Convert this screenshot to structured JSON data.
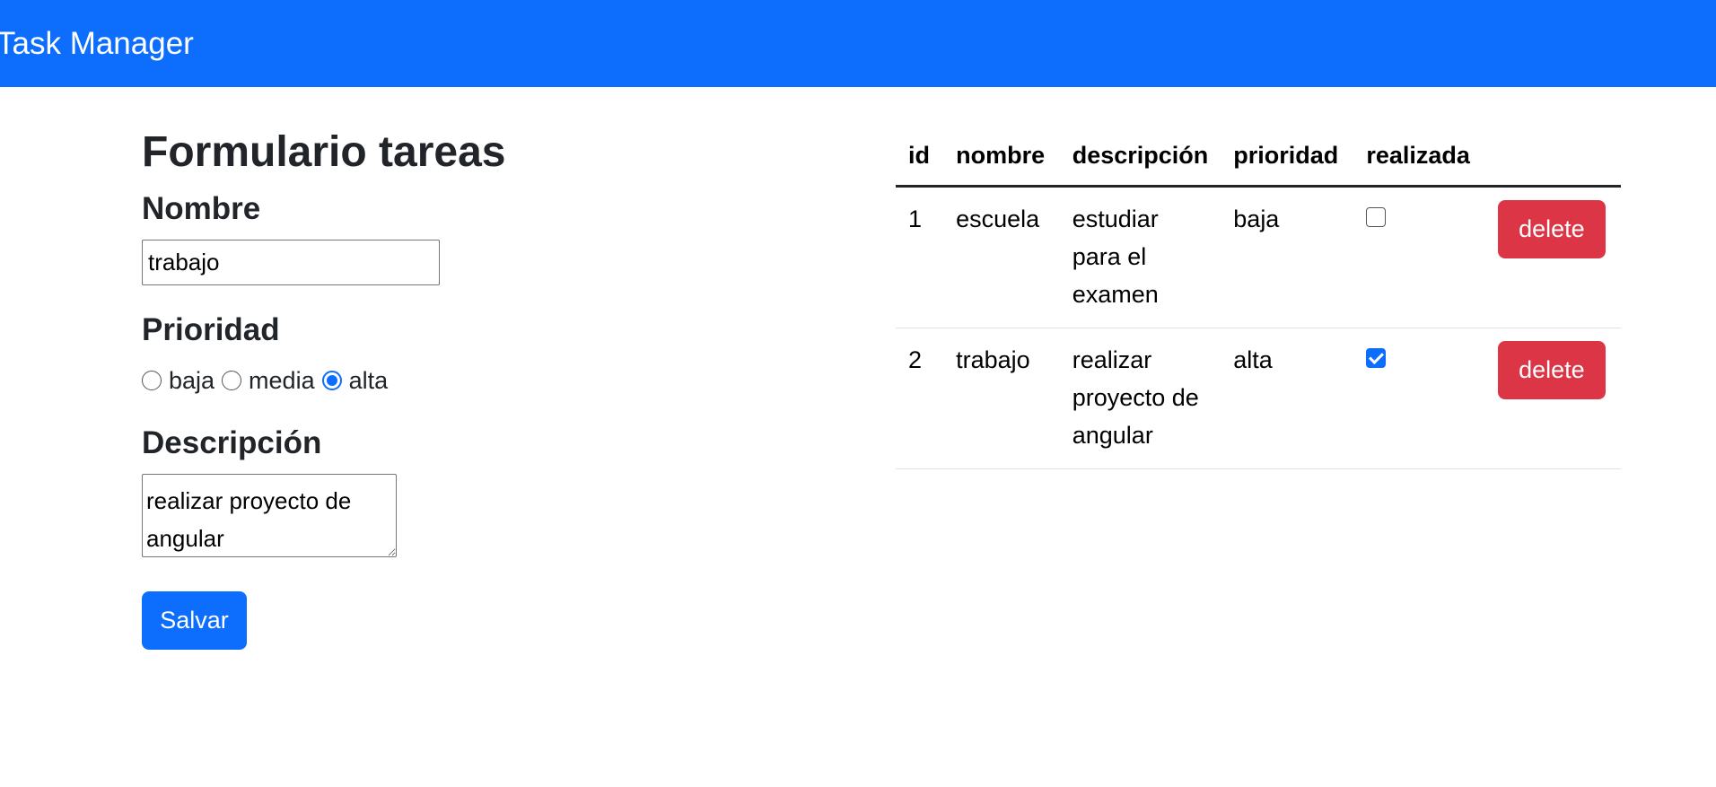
{
  "navbar": {
    "brand": "Task Manager",
    "color": "#0d6efd"
  },
  "form": {
    "title": "Formulario tareas",
    "name_label": "Nombre",
    "name_value": "trabajo",
    "priority_label": "Prioridad",
    "priority_options": [
      {
        "label": "baja",
        "checked": false
      },
      {
        "label": "media",
        "checked": false
      },
      {
        "label": "alta",
        "checked": true
      }
    ],
    "description_label": "Descripción",
    "description_value": "realizar proyecto de angular",
    "save_label": "Salvar"
  },
  "table": {
    "headers": [
      "id",
      "nombre",
      "descripción",
      "prioridad",
      "realizada",
      ""
    ],
    "rows": [
      {
        "id": "1",
        "nombre": "escuela",
        "descripcion": "estudiar para el examen",
        "prioridad": "baja",
        "realizada": false,
        "action": "delete"
      },
      {
        "id": "2",
        "nombre": "trabajo",
        "descripcion": "realizar proyecto de angular",
        "prioridad": "alta",
        "realizada": true,
        "action": "delete"
      }
    ]
  },
  "colors": {
    "primary": "#0d6efd",
    "danger": "#dc3545",
    "text": "#212529"
  }
}
